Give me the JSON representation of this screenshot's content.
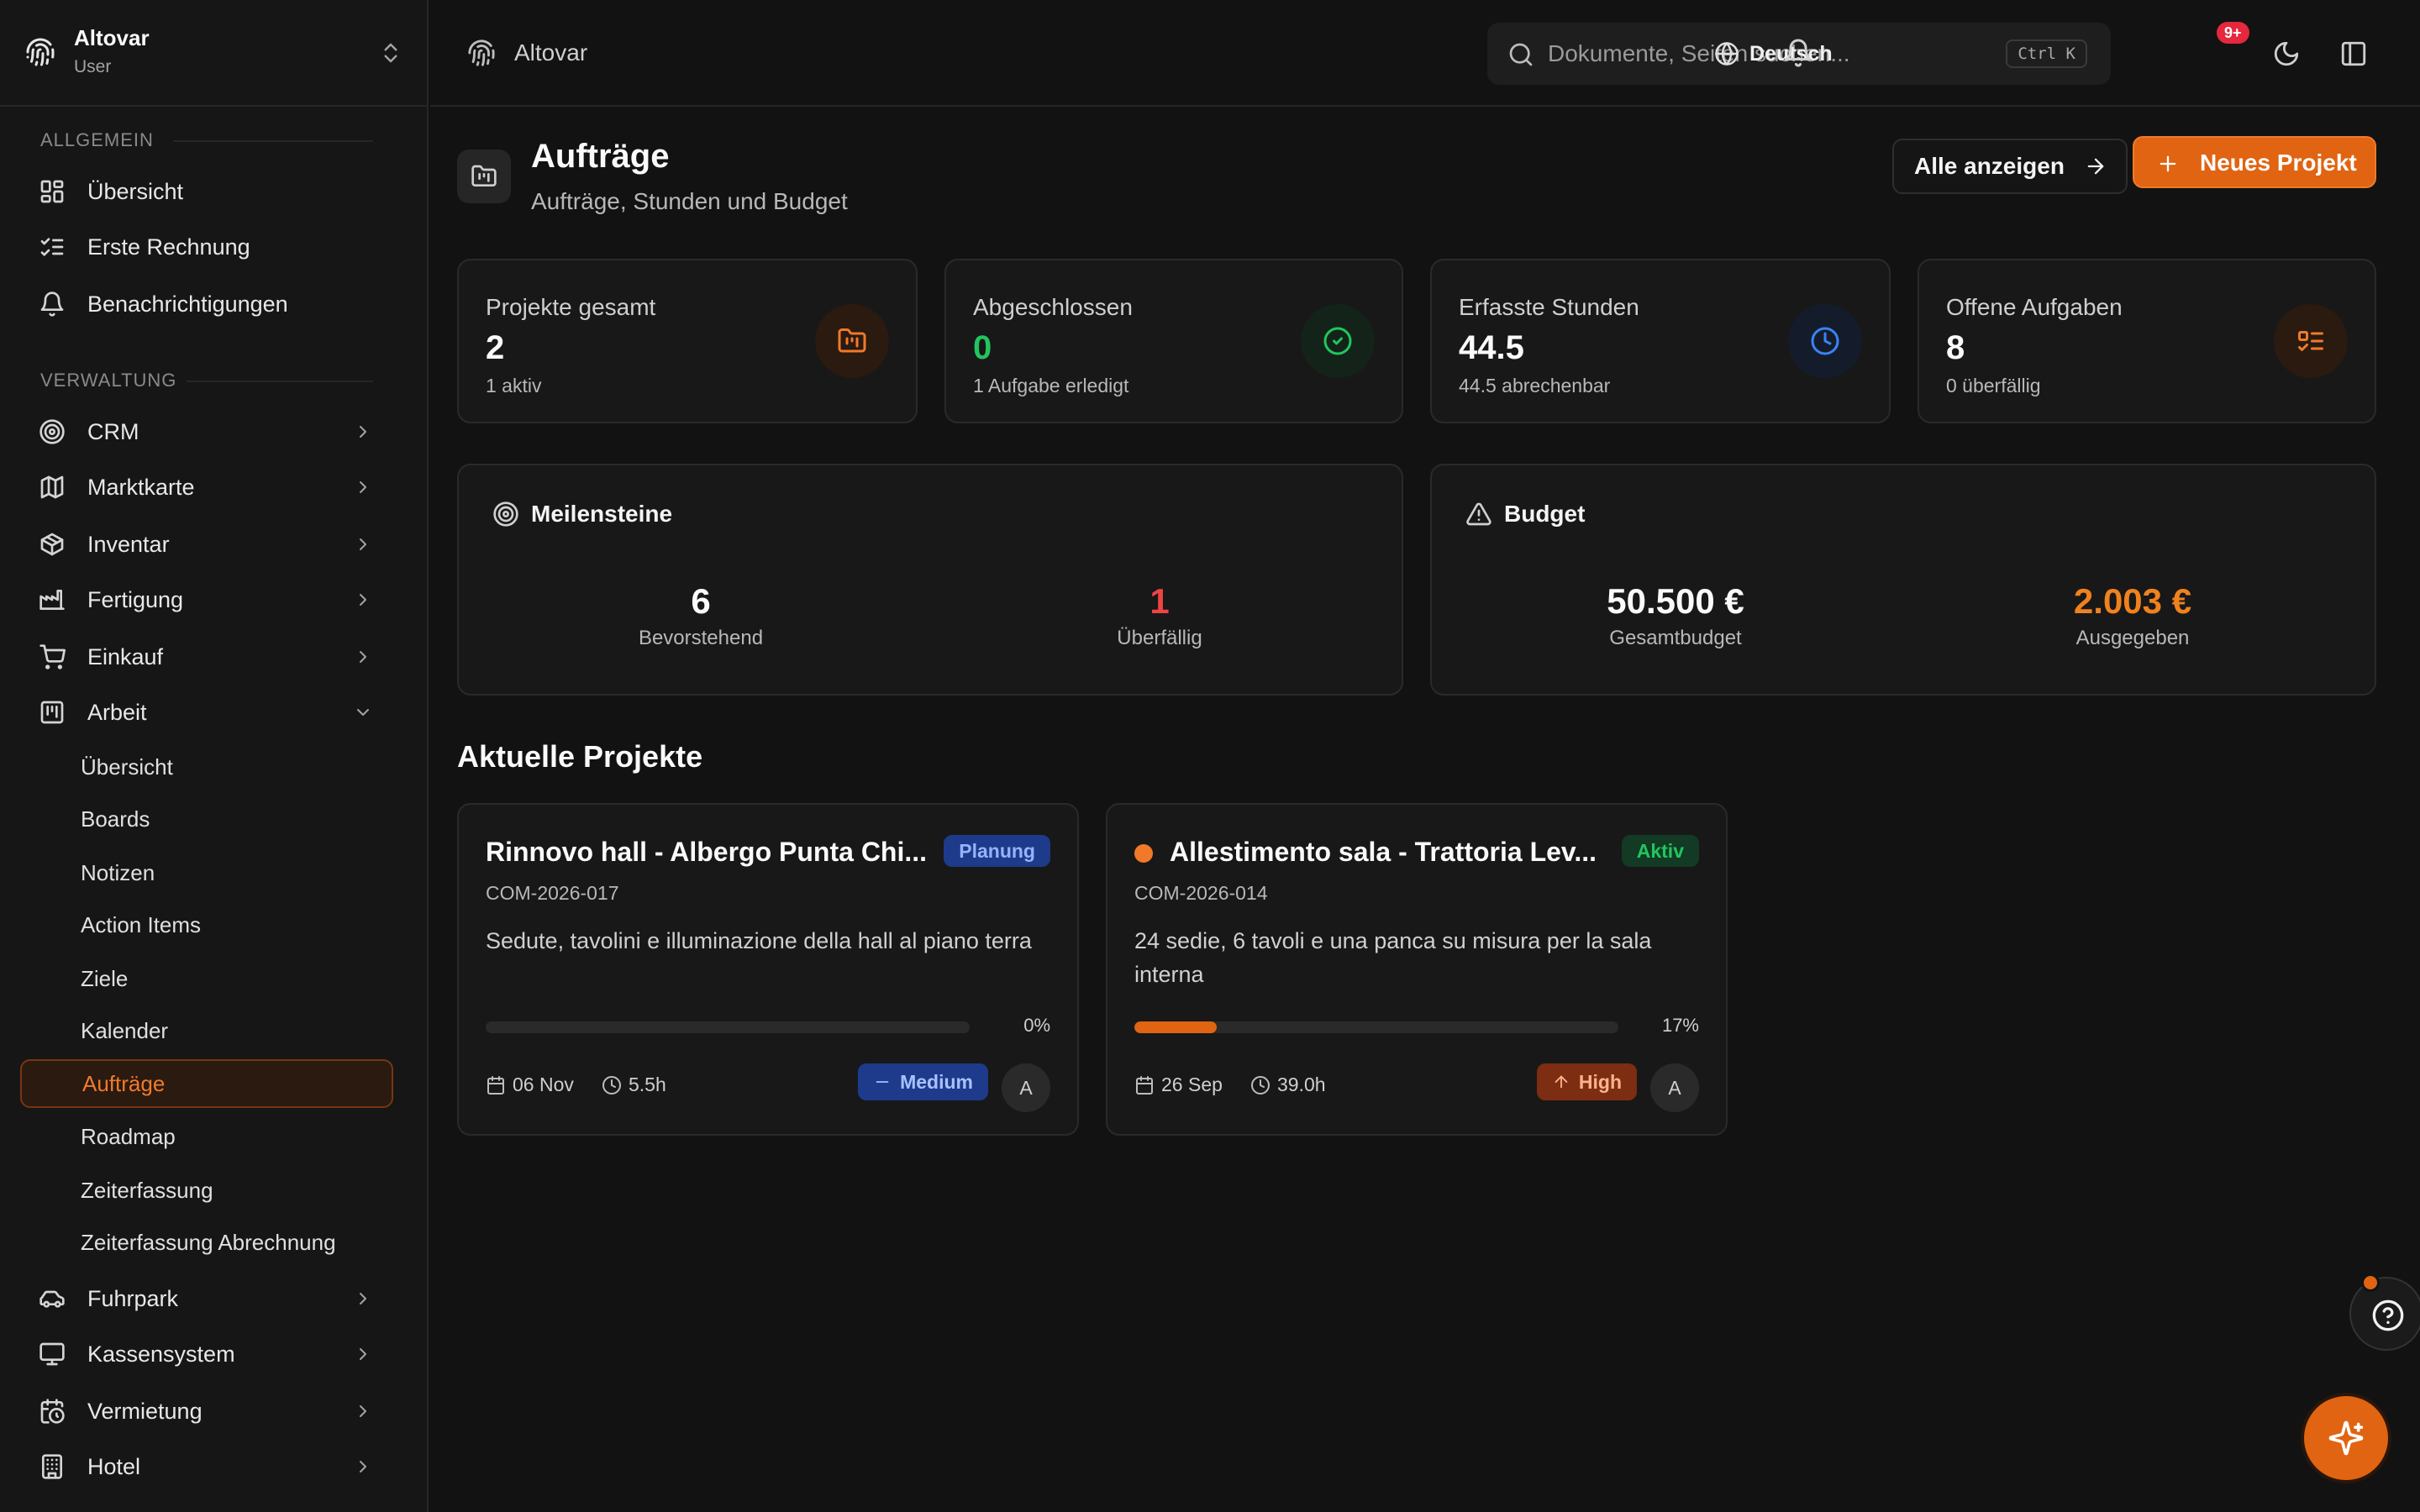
{
  "org": {
    "name": "Altovar",
    "role": "User"
  },
  "sidebar": {
    "section_general": "ALLGEMEIN",
    "general_items": [
      {
        "label": "Übersicht",
        "icon": "dashboard-icon"
      },
      {
        "label": "Erste Rechnung",
        "icon": "checklist-icon"
      },
      {
        "label": "Benachrichtigungen",
        "icon": "bell-icon"
      }
    ],
    "section_admin": "VERWALTUNG",
    "admin_items": [
      {
        "label": "CRM",
        "icon": "target-icon"
      },
      {
        "label": "Marktkarte",
        "icon": "map-icon"
      },
      {
        "label": "Inventar",
        "icon": "box-icon"
      },
      {
        "label": "Fertigung",
        "icon": "factory-icon"
      },
      {
        "label": "Einkauf",
        "icon": "cart-icon"
      },
      {
        "label": "Arbeit",
        "icon": "kanban-icon"
      }
    ],
    "work_subitems": [
      {
        "label": "Übersicht"
      },
      {
        "label": "Boards"
      },
      {
        "label": "Notizen"
      },
      {
        "label": "Action Items"
      },
      {
        "label": "Ziele"
      },
      {
        "label": "Kalender"
      },
      {
        "label": "Aufträge",
        "active": true
      },
      {
        "label": "Roadmap"
      },
      {
        "label": "Zeiterfassung"
      },
      {
        "label": "Zeiterfassung Abrechnung"
      }
    ],
    "bottom_items": [
      {
        "label": "Fuhrpark",
        "icon": "car-icon"
      },
      {
        "label": "Kassensystem",
        "icon": "monitor-icon"
      },
      {
        "label": "Vermietung",
        "icon": "calendar-clock-icon"
      },
      {
        "label": "Hotel",
        "icon": "building-icon"
      }
    ]
  },
  "topbar": {
    "breadcrumb": "Altovar",
    "search_placeholder": "Dokumente, Seiten suchen...",
    "search_shortcut": "Ctrl K",
    "language": "Deutsch",
    "notification_badge": "9+"
  },
  "page": {
    "title": "Aufträge",
    "subtitle": "Aufträge, Stunden und Budget",
    "show_all_label": "Alle anzeigen",
    "new_project_label": "Neues Projekt"
  },
  "stats": [
    {
      "title": "Projekte gesamt",
      "value": "2",
      "sub": "1 aktiv",
      "icon": "folder-kanban-icon",
      "value_color": "#fafafa",
      "icon_color": "#f07a2a",
      "icon_bg": "#2a1a10"
    },
    {
      "title": "Abgeschlossen",
      "value": "0",
      "sub": "1 Aufgabe erledigt",
      "icon": "check-circle-icon",
      "value_color": "#22c55e",
      "icon_color": "#22c55e",
      "icon_bg": "#13231a"
    },
    {
      "title": "Erfasste Stunden",
      "value": "44.5",
      "sub": "44.5 abrechenbar",
      "icon": "clock-icon",
      "value_color": "#fafafa",
      "icon_color": "#3b82f6",
      "icon_bg": "#141c2b"
    },
    {
      "title": "Offene Aufgaben",
      "value": "8",
      "sub": "0 überfällig",
      "icon": "list-todo-icon",
      "value_color": "#fafafa",
      "icon_color": "#f07a2a",
      "icon_bg": "#2a1a10"
    }
  ],
  "milestones": {
    "title": "Meilensteine",
    "upcoming_value": "6",
    "upcoming_label": "Bevorstehend",
    "overdue_value": "1",
    "overdue_label": "Überfällig",
    "overdue_color": "#ef4444"
  },
  "budget": {
    "title": "Budget",
    "total_value": "50.500 €",
    "total_label": "Gesamtbudget",
    "spent_value": "2.003 €",
    "spent_label": "Ausgegeben",
    "spent_color": "#f0821e"
  },
  "projects_section_title": "Aktuelle Projekte",
  "projects": [
    {
      "title": "Rinnovo hall - Albergo Punta Chi...",
      "status": "Planung",
      "code": "COM-2026-017",
      "description": "Sedute, tavolini e illuminazione della hall al piano terra",
      "progress": 0,
      "progress_label": "0%",
      "date": "06 Nov",
      "hours": "5.5h",
      "priority": "Medium",
      "avatar": "A",
      "has_dot": false
    },
    {
      "title": "Allestimento sala - Trattoria Lev...",
      "status": "Aktiv",
      "code": "COM-2026-014",
      "description": "24 sedie, 6 tavoli e una panca su misura per la sala interna",
      "progress": 17,
      "progress_label": "17%",
      "date": "26 Sep",
      "hours": "39.0h",
      "priority": "High",
      "avatar": "A",
      "has_dot": true
    }
  ],
  "colors": {
    "accent": "#e06411",
    "planung_bg": "#1e3a8a",
    "planung_fg": "#93b4ff",
    "aktiv_bg": "#123a24",
    "aktiv_fg": "#22c55e",
    "medium_bg": "#1e3a8a",
    "medium_fg": "#a8c1ff",
    "high_bg": "#7c2d12",
    "high_fg": "#ffb38a"
  }
}
